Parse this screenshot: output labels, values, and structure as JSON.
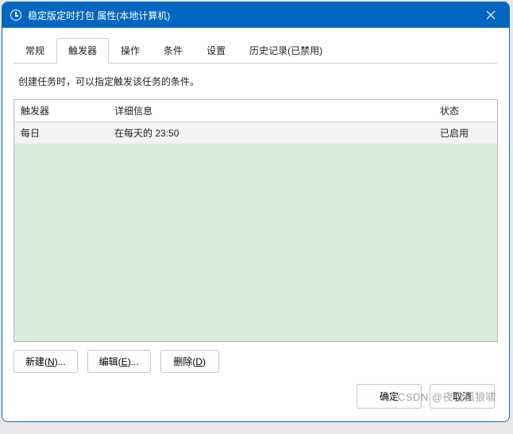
{
  "window": {
    "title": "稳定版定时打包 属性(本地计算机)"
  },
  "tabs": [
    {
      "label": "常规"
    },
    {
      "label": "触发器"
    },
    {
      "label": "操作"
    },
    {
      "label": "条件"
    },
    {
      "label": "设置"
    },
    {
      "label": "历史记录(已禁用)"
    }
  ],
  "active_tab_index": 1,
  "description": "创建任务时，可以指定触发该任务的条件。",
  "table": {
    "headers": {
      "trigger": "触发器",
      "detail": "详细信息",
      "status": "状态"
    },
    "rows": [
      {
        "trigger": "每日",
        "detail": "在每天的 23:50",
        "status": "已启用"
      }
    ]
  },
  "buttons": {
    "new": "新建(N)...",
    "edit": "编辑(E)...",
    "delete": "删除(D)"
  },
  "footer": {
    "ok": "确定",
    "cancel": "取消"
  },
  "watermark": "CSDN @夜空孤狼啸"
}
